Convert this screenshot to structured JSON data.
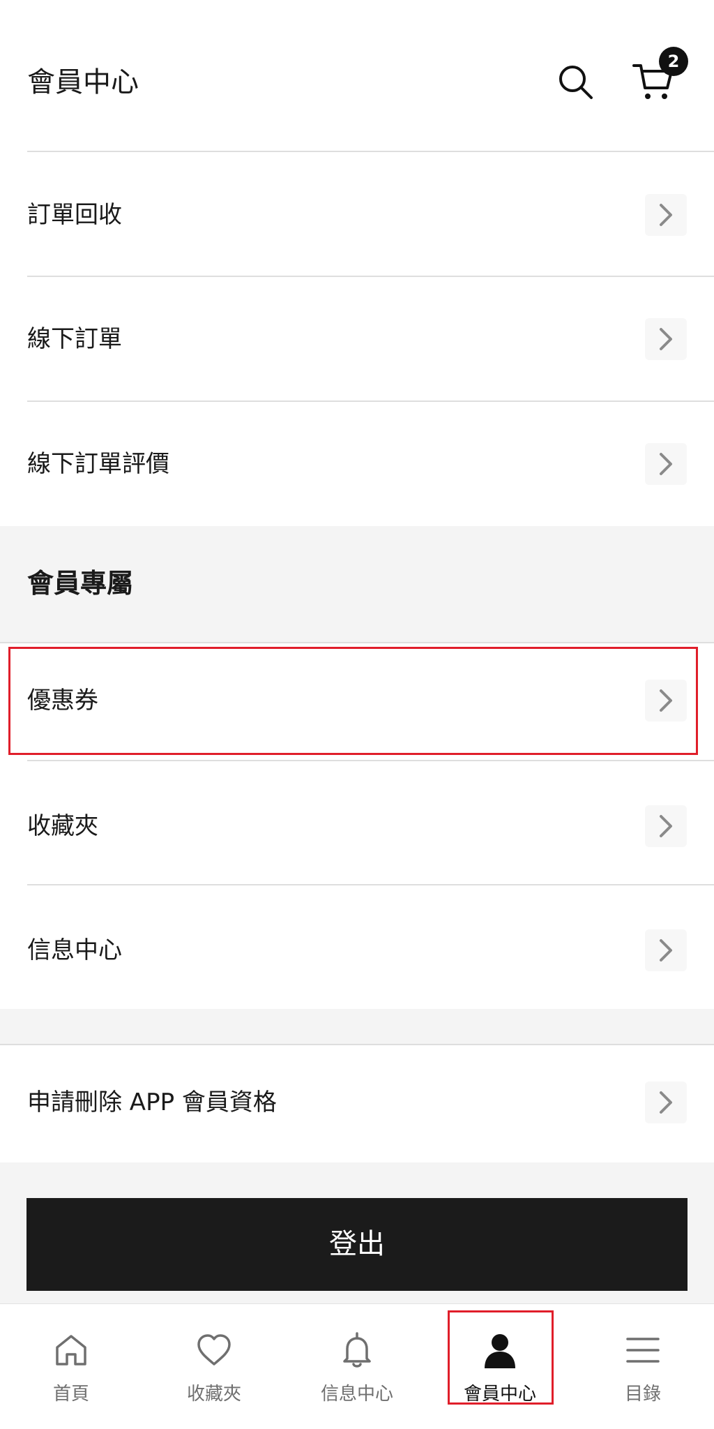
{
  "header": {
    "title": "會員中心",
    "cart_count": "2",
    "icons": [
      "search-icon",
      "cart-icon"
    ]
  },
  "orders_section": {
    "items": [
      {
        "label": "訂單回收"
      },
      {
        "label": "線下訂單"
      },
      {
        "label": "線下訂單評價"
      }
    ]
  },
  "member_section": {
    "heading": "會員專屬",
    "items": [
      {
        "label": "優惠券"
      },
      {
        "label": "收藏夾"
      },
      {
        "label": "信息中心"
      }
    ]
  },
  "account_section": {
    "items": [
      {
        "label": "申請刪除 APP 會員資格"
      }
    ]
  },
  "logout_label": "登出",
  "bottom_nav": {
    "items": [
      {
        "label": "首頁",
        "icon": "home-icon"
      },
      {
        "label": "收藏夾",
        "icon": "heart-icon"
      },
      {
        "label": "信息中心",
        "icon": "bell-icon"
      },
      {
        "label": "會員中心",
        "icon": "person-icon",
        "active": true
      },
      {
        "label": "目錄",
        "icon": "menu-icon"
      }
    ]
  },
  "colors": {
    "highlight": "#e01e2a",
    "button_bg": "#1b1b1b",
    "page_bg": "#f4f4f4"
  }
}
